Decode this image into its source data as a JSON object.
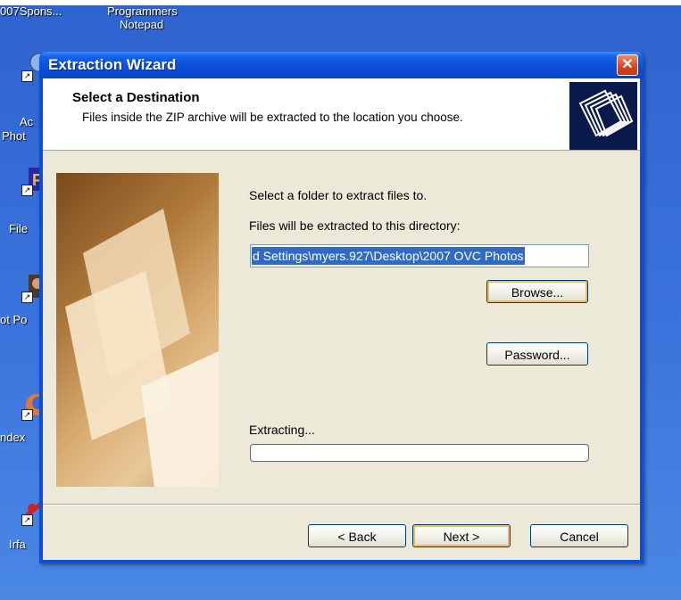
{
  "desktop": {
    "top_labels": [
      "007Spons...",
      "Programmers",
      "Notepad"
    ],
    "side_labels": [
      "Ac",
      "Phot",
      "File",
      "ot Po",
      "ndex",
      "Irfa"
    ]
  },
  "dialog": {
    "title": "Extraction Wizard",
    "close_symbol": "✕",
    "header": {
      "title": "Select a Destination",
      "description": "Files inside the ZIP archive will be extracted to the location you choose."
    },
    "select_folder_label": "Select a folder to extract files to.",
    "directory_label": "Files will be extracted to this directory:",
    "directory_value": "d Settings\\myers.927\\Desktop\\2007 OVC Photos",
    "browse_button": "Browse...",
    "password_button": "Password...",
    "extracting_label": "Extracting...",
    "progress_value": 0,
    "back_button": "< Back",
    "next_button": "Next >",
    "cancel_button": "Cancel"
  },
  "colors": {
    "title_bar": "#0a4fd6",
    "dialog_bg": "#ece9d8",
    "selection": "#316ac5",
    "close_button": "#d9461e"
  }
}
